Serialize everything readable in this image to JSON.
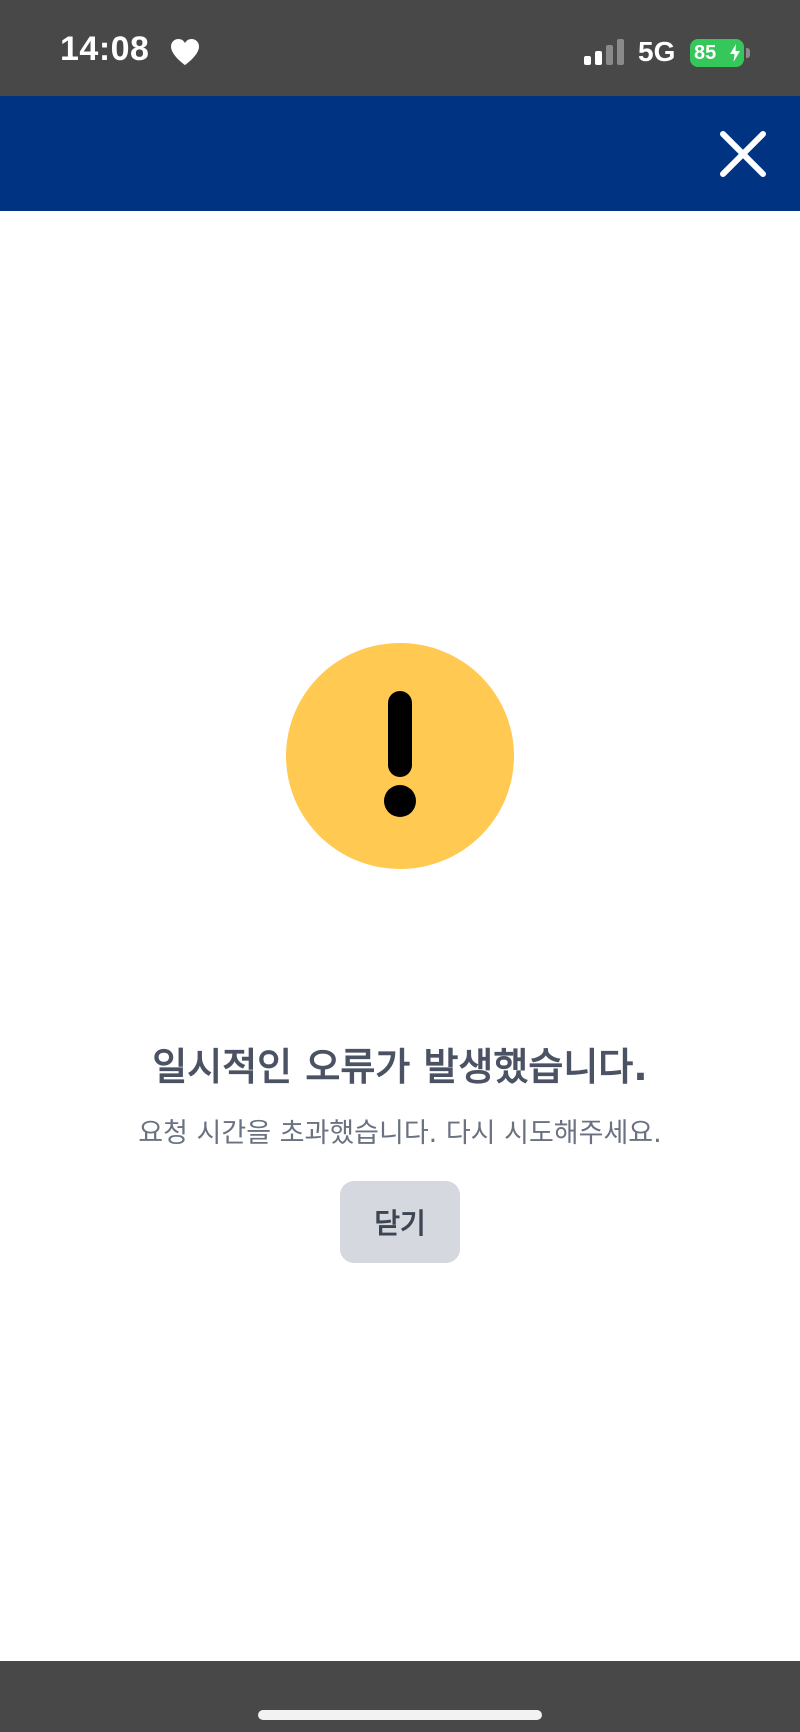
{
  "status_bar": {
    "time": "14:08",
    "network": "5G",
    "battery_percent": "85",
    "signal_bars_active": 2,
    "signal_bars_total": 4,
    "icons": [
      "heart-icon",
      "signal-icon",
      "battery-bolt-icon"
    ]
  },
  "header": {
    "close_icon": "close-icon",
    "background_color": "#003482"
  },
  "error": {
    "icon": "warning-icon",
    "icon_color": "#FFC952",
    "title": "일시적인 오류가 발생했습니다.",
    "message": "요청 시간을 초과했습니다. 다시 시도해주세요.",
    "button_label": "닫기"
  }
}
